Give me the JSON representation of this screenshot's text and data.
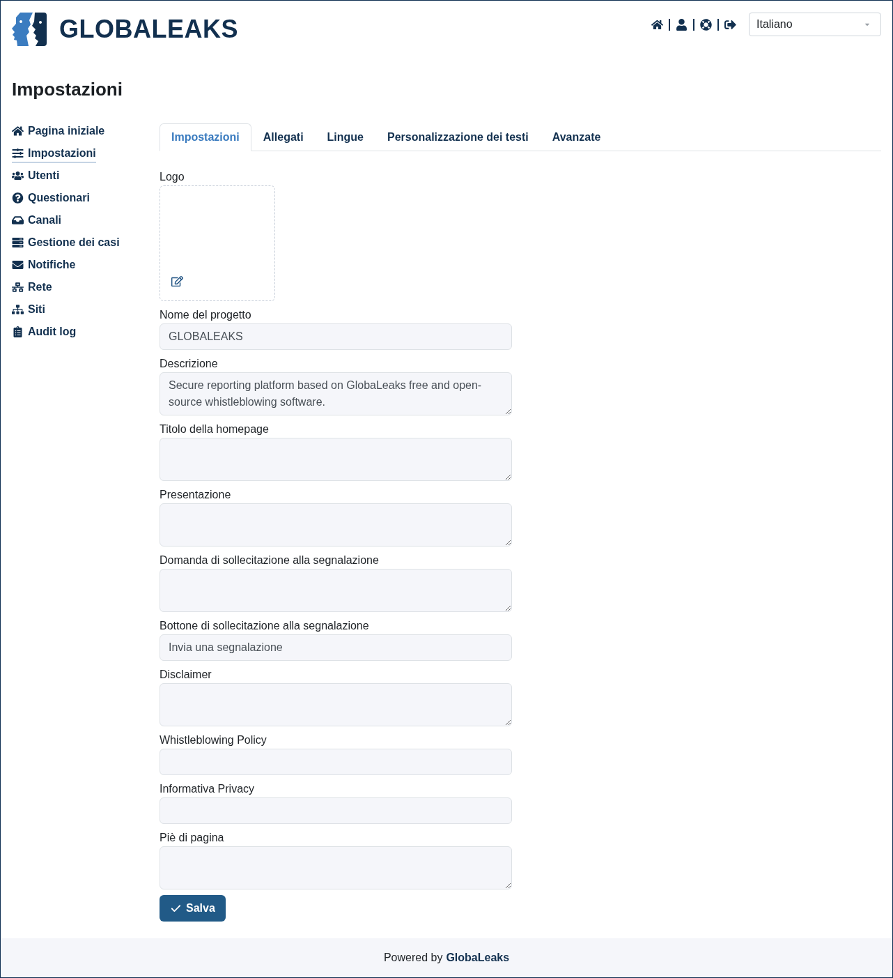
{
  "header": {
    "logo_text": "GLOBALEAKS",
    "language_select": {
      "value": "Italiano"
    }
  },
  "page_title": "Impostazioni",
  "sidebar": {
    "items": [
      {
        "label": "Pagina iniziale",
        "selected": false
      },
      {
        "label": "Impostazioni",
        "selected": true
      },
      {
        "label": "Utenti",
        "selected": false
      },
      {
        "label": "Questionari",
        "selected": false
      },
      {
        "label": "Canali",
        "selected": false
      },
      {
        "label": "Gestione dei casi",
        "selected": false
      },
      {
        "label": "Notifiche",
        "selected": false
      },
      {
        "label": "Rete",
        "selected": false
      },
      {
        "label": "Siti",
        "selected": false
      },
      {
        "label": "Audit log",
        "selected": false
      }
    ]
  },
  "tabs": [
    {
      "label": "Impostazioni",
      "selected": true
    },
    {
      "label": "Allegati",
      "selected": false
    },
    {
      "label": "Lingue",
      "selected": false
    },
    {
      "label": "Personalizzazione dei testi",
      "selected": false
    },
    {
      "label": "Avanzate",
      "selected": false
    }
  ],
  "form": {
    "logo": {
      "label": "Logo"
    },
    "fields": [
      {
        "label": "Nome del progetto",
        "kind": "input",
        "value": "GLOBALEAKS"
      },
      {
        "label": "Descrizione",
        "kind": "textarea",
        "value": "Secure reporting platform based on GlobaLeaks free and open-source whistleblowing software."
      },
      {
        "label": "Titolo della homepage",
        "kind": "textarea"
      },
      {
        "label": "Presentazione",
        "kind": "textarea"
      },
      {
        "label": "Domanda di sollecitazione alla segnalazione",
        "kind": "textarea"
      },
      {
        "label": "Bottone di sollecitazione alla segnalazione",
        "kind": "input",
        "value": "Invia una segnalazione"
      },
      {
        "label": "Disclaimer",
        "kind": "textarea"
      },
      {
        "label": "Whistleblowing Policy",
        "kind": "input"
      },
      {
        "label": "Informativa Privacy",
        "kind": "input"
      },
      {
        "label": "Piè di pagina",
        "kind": "textarea"
      }
    ],
    "save_button": {
      "label": "Salva"
    }
  },
  "footer": {
    "text": "Powered by",
    "link": "GlobaLeaks"
  }
}
